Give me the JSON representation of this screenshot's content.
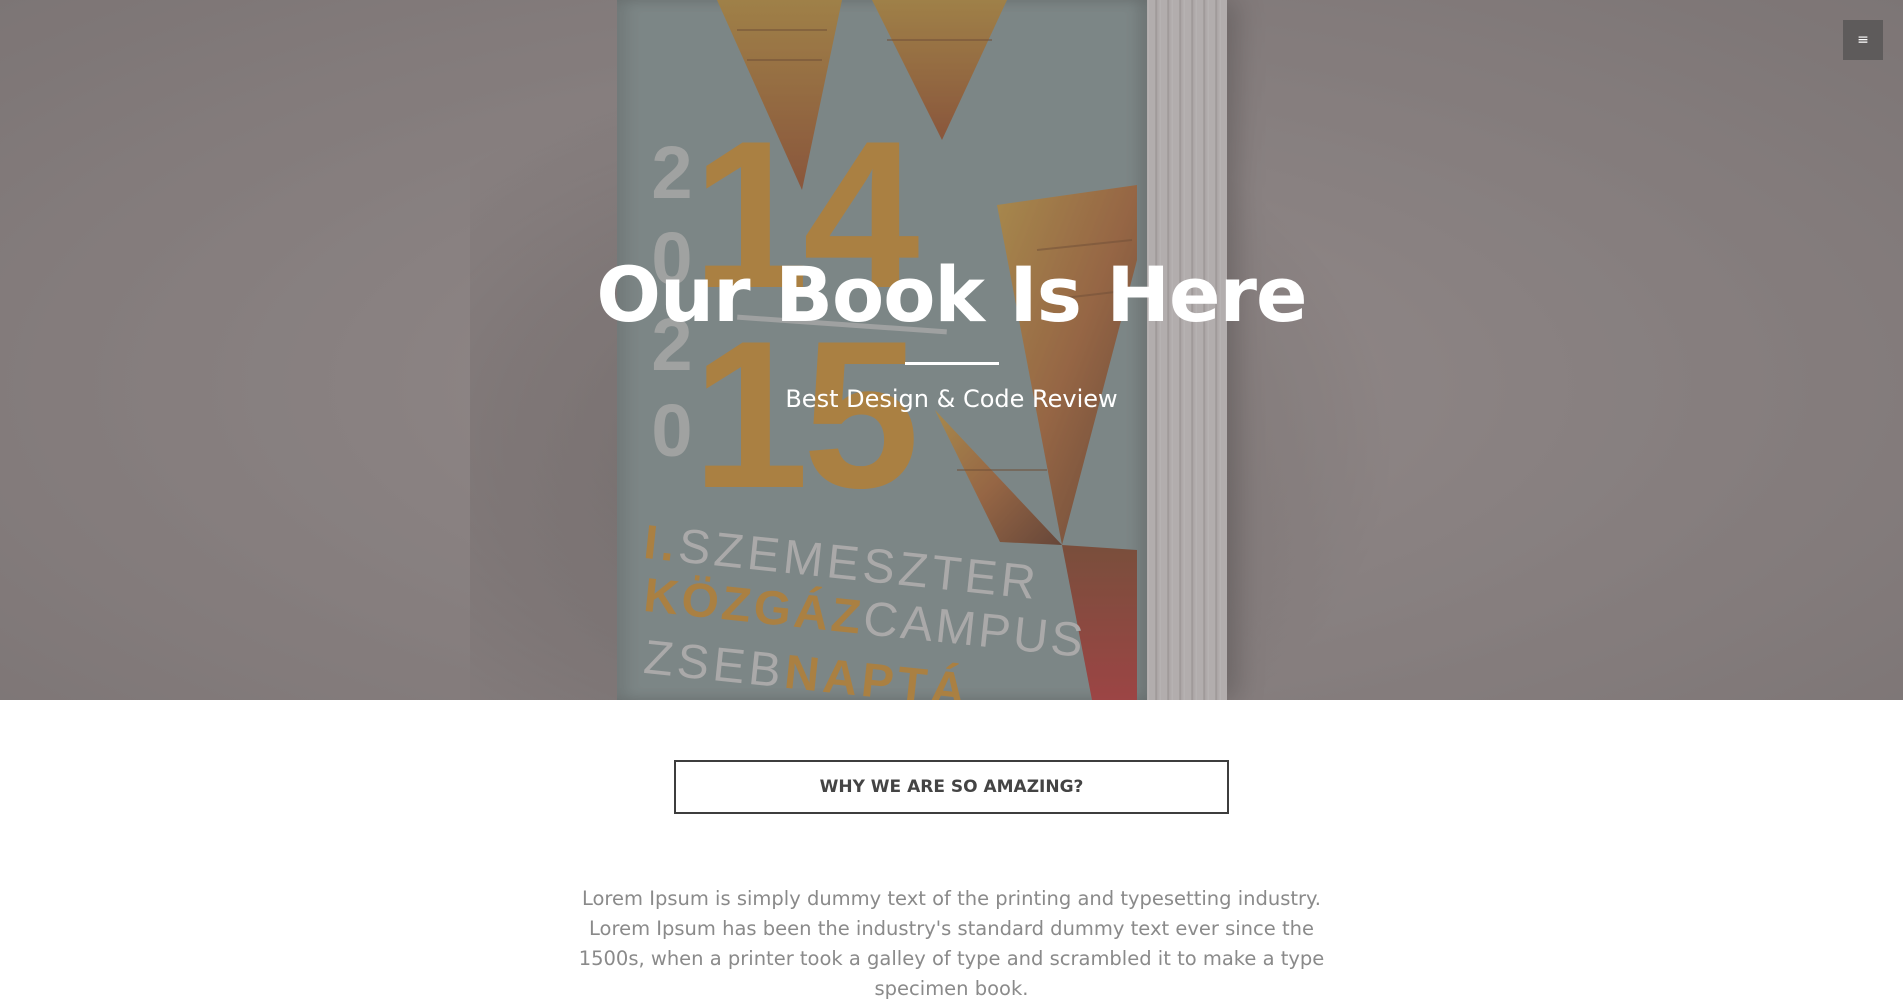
{
  "hero": {
    "title": "Our Book Is Here",
    "subtitle": "Best Design & Code Review",
    "menu_icon": "hamburger-menu-icon",
    "menu_glyph": "≡",
    "overlay_color": "#5f5858"
  },
  "book_cover": {
    "years_small": [
      "2",
      "0",
      "2",
      "0"
    ],
    "year_top": "14",
    "year_bottom": "15",
    "line1_highlight": "I.",
    "line1_rest": "SZEMESZTER",
    "line2_highlight": "KÖZGÁZ",
    "line2_rest": "CAMPUS",
    "line3_start": "ZSEB",
    "line3_highlight": "NAPTÁ",
    "accent_color": "#d99a36"
  },
  "main": {
    "section_button_label": "WHY WE ARE SO AMAZING?",
    "body_text": "Lorem Ipsum is simply dummy text of the printing and typesetting industry. Lorem Ipsum has been the industry's standard dummy text ever since the 1500s, when a printer took a galley of type and scrambled it to make a type specimen book."
  }
}
